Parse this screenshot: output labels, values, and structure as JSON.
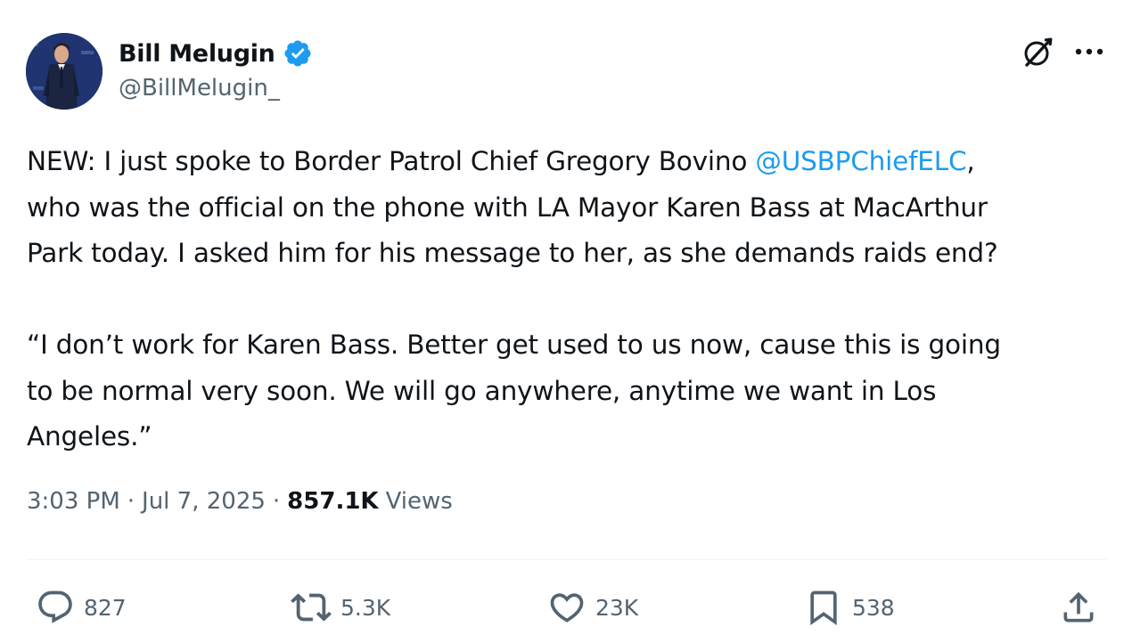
{
  "author": {
    "display_name": "Bill Melugin",
    "handle": "@BillMelugin_",
    "verified": true,
    "verified_color": "#1d9bf0"
  },
  "header_icons": {
    "grok": "grok-icon",
    "more": "more-options-icon"
  },
  "tweet": {
    "line1_pre": "NEW: I just spoke to Border Patrol Chief Gregory Bovino ",
    "line1_mention": "@USBPChiefELC",
    "line1_post": ",",
    "line2": "who was the official on the phone with LA Mayor Karen Bass at MacArthur",
    "line3": "Park today. I asked him for his message to her, as she demands raids end?",
    "line4": "“I don’t work for Karen Bass. Better get used to us now, cause this is going",
    "line5": "to be normal very soon. We will go anywhere, anytime we want in Los",
    "line6": "Angeles.”"
  },
  "meta": {
    "time": "3:03 PM",
    "separator": "·",
    "date": "Jul 7, 2025",
    "views_count": "857.1K",
    "views_label": "Views"
  },
  "actions": {
    "reply": {
      "icon": "reply-icon",
      "count": "827"
    },
    "repost": {
      "icon": "repost-icon",
      "count": "5.3K"
    },
    "like": {
      "icon": "heart-icon",
      "count": "23K"
    },
    "bookmark": {
      "icon": "bookmark-icon",
      "count": "538"
    },
    "share": {
      "icon": "share-icon"
    }
  },
  "colors": {
    "text": "#0f1419",
    "secondary": "#536471",
    "link": "#1d9bf0",
    "divider": "#eff3f4"
  }
}
